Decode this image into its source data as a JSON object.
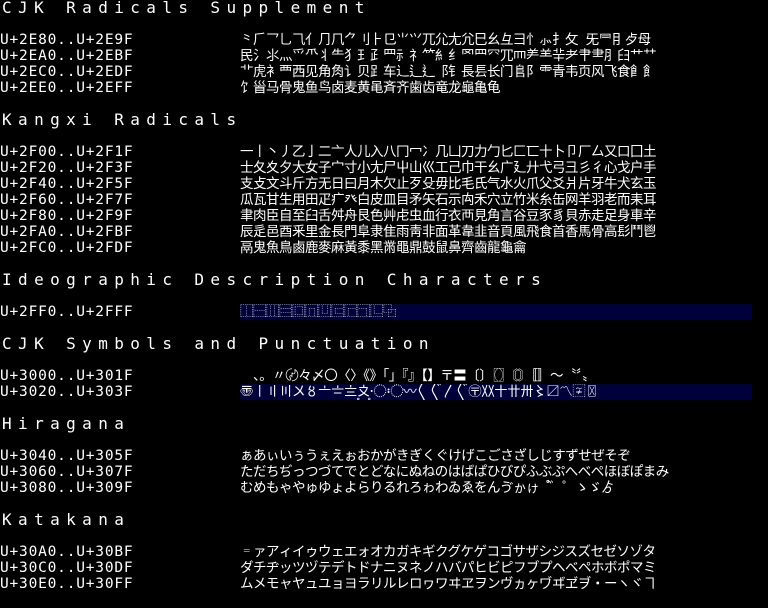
{
  "theme": {
    "background": "#000000",
    "text": "#ffffff",
    "band": "#00003a"
  },
  "sections": [
    {
      "title": "CJK Radicals Supplement",
      "rows": [
        {
          "range": "U+2E80..U+2E9F",
          "glyphs": "⺀⺁⺂⺃⺄⺅⺆⺇⺈⺉⺊⺋⺌⺍⺎⺏⺐⺑⺒⺓⺔⺕⺖⺗⺘⺙ ⺛⺜⺝⺞⺟"
        },
        {
          "range": "U+2EA0..U+2EBF",
          "glyphs": "⺠⺡⺢⺣⺤⺥⺦⺧⺨⺩⺪⺫⺬⺭⺮⺯⺰⺱⺲⺳⺴⺵⺶⺷⺸⺹⺺⺻⺼⺽⺾⺿"
        },
        {
          "range": "U+2EC0..U+2EDF",
          "glyphs": "⻀⻁⻂⻃⻄⻅⻆⻇⻈⻉⻊⻋⻌⻍⻎⻏⻐⻑⻒⻓⻔⻕⻖⻗⻘⻙⻚⻛⻜⻝⻞⻟"
        },
        {
          "range": "U+2EE0..U+2EFF",
          "glyphs": "⻠⻡⻢⻣⻤⻥⻦⻧⻨⻩⻪⻫⻬⻭⻮⻯⻰⻱⻲⻳"
        }
      ]
    },
    {
      "title": "Kangxi Radicals",
      "rows": [
        {
          "range": "U+2F00..U+2F1F",
          "glyphs": "⼀⼁⼂⼃⼄⼅⼆⼇⼈⼉⼊⼋⼌⼍⼎⼏⼐⼑⼒⼓⼔⼕⼖⼗⼘⼙⼚⼛⼜⼝⼞⼟"
        },
        {
          "range": "U+2F20..U+2F3F",
          "glyphs": "⼠⼡⼢⼣⼤⼥⼦⼧⼨⼩⼪⼫⼬⼭⼮⼯⼰⼱⼲⼳⼴⼵⼶⼷⼸⼹⼺⼻⼼⼽⼾⼿"
        },
        {
          "range": "U+2F40..U+2F5F",
          "glyphs": "⽀⽁⽂⽃⽄⽅⽆⽇⽈⽉⽊⽋⽌⽍⽎⽏⽐⽑⽒⽓⽔⽕⽖⽗⽘⽙⽚⽛⽜⽝⽞⽟"
        },
        {
          "range": "U+2F60..U+2F7F",
          "glyphs": "⽠⽡⽢⽣⽤⽥⽦⽧⽨⽩⽪⽫⽬⽭⽮⽯⽰⽱⽲⽳⽴⽵⽶⽷⽸⽹⽺⽻⽼⽽⽾⽿"
        },
        {
          "range": "U+2F80..U+2F9F",
          "glyphs": "⾀⾁⾂⾃⾄⾅⾆⾇⾈⾉⾊⾋⾌⾍⾎⾏⾐⾑⾒⾓⾔⾕⾖⾗⾘⾙⾚⾛⾜⾝⾞⾟"
        },
        {
          "range": "U+2FA0..U+2FBF",
          "glyphs": "⾠⾡⾢⾣⾤⾥⾦⾧⾨⾩⾪⾫⾬⾭⾮⾯⾰⾱⾲⾳⾴⾵⾶⾷⾸⾹⾺⾻⾼⾽⾾⾿"
        },
        {
          "range": "U+2FC0..U+2FDF",
          "glyphs": "⿀⿁⿂⿃⿄⿅⿆⿇⿈⿉⿊⿋⿌⿍⿎⿏⿐⿑⿒⿓⿔⿕"
        }
      ]
    },
    {
      "title": "Ideographic Description Characters",
      "rows": [
        {
          "range": "U+2FF0..U+2FFF",
          "glyphs": "⿰⿱⿲⿳⿴⿵⿶⿷⿸⿹⿺⿻",
          "band": true
        }
      ]
    },
    {
      "title": "CJK Symbols and Punctuation",
      "rows": [
        {
          "range": "U+3000..U+301F",
          "glyphs": "　、。〃〄々〆〇〈〉《》「」『』【】〒〓〔〕〖〗〘〙〚〛〜〝〞〟"
        },
        {
          "range": "U+3020..U+303F",
          "glyphs": "〠〡〢〣〤〥〦〧〨〩〪〭〮〯〫〬〰〱〲〳〴〵〶〷〸〹〺〻〼〽〾〿",
          "band": true
        }
      ]
    },
    {
      "title": "Hiragana",
      "rows": [
        {
          "range": "U+3040..U+305F",
          "glyphs": "ぁあぃいぅうぇえぉおかがきぎくぐけげこごさざしじすずせぜそぞ"
        },
        {
          "range": "U+3060..U+307F",
          "glyphs": "ただちぢっつづてでとどなにぬねのはばぱひびぴふぶぷへべぺほぼぽまみ"
        },
        {
          "range": "U+3080..U+309F",
          "glyphs": "むめもゃやゅゆょよらりるれろゎわゐゑをんゔゕゖ  ゙゚゛゜ゝゞゟ"
        }
      ]
    },
    {
      "title": "Katakana",
      "rows": [
        {
          "range": "U+30A0..U+30BF",
          "glyphs": "゠ァアィイゥウェエォオカガキギクグケゲコゴサザシジスズセゼソゾタ"
        },
        {
          "range": "U+30C0..U+30DF",
          "glyphs": "ダチヂッツヅテデトドナニヌネノハバパヒビピフブプヘベペホボポマミ"
        },
        {
          "range": "U+30E0..U+30FF",
          "glyphs": "ムメモャヤュユョヨラリルレロヮワヰヱヲンヴヵヶヷヸヹヺ・ーヽヾヿ"
        }
      ]
    }
  ]
}
